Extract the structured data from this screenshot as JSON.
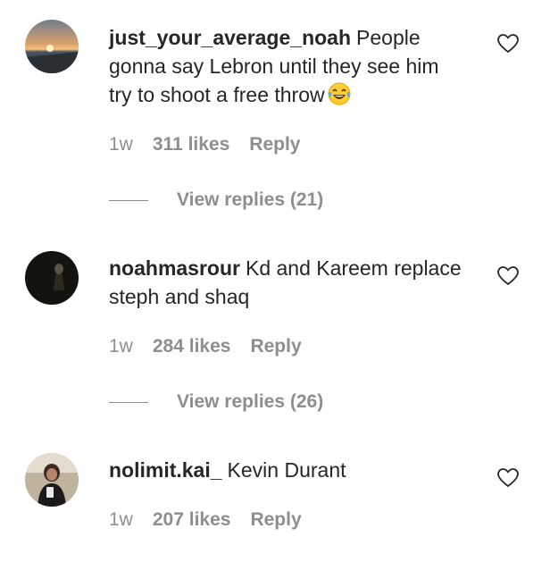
{
  "comments": [
    {
      "username": "just_your_average_noah",
      "text": "People gonna say Lebron until they see him try to shoot a free throw",
      "emoji": "😂",
      "time": "1w",
      "likes": "311 likes",
      "reply": "Reply",
      "view_replies": "View replies (21)"
    },
    {
      "username": "noahmasrour",
      "text": "Kd and Kareem replace steph and shaq",
      "time": "1w",
      "likes": "284 likes",
      "reply": "Reply",
      "view_replies": "View replies (26)"
    },
    {
      "username": "nolimit.kai_",
      "text": "Kevin Durant",
      "time": "1w",
      "likes": "207 likes",
      "reply": "Reply"
    }
  ],
  "icons": {
    "like": "heart-outline-icon"
  },
  "colors": {
    "text": "#262626",
    "secondary": "#8e8e8e"
  }
}
